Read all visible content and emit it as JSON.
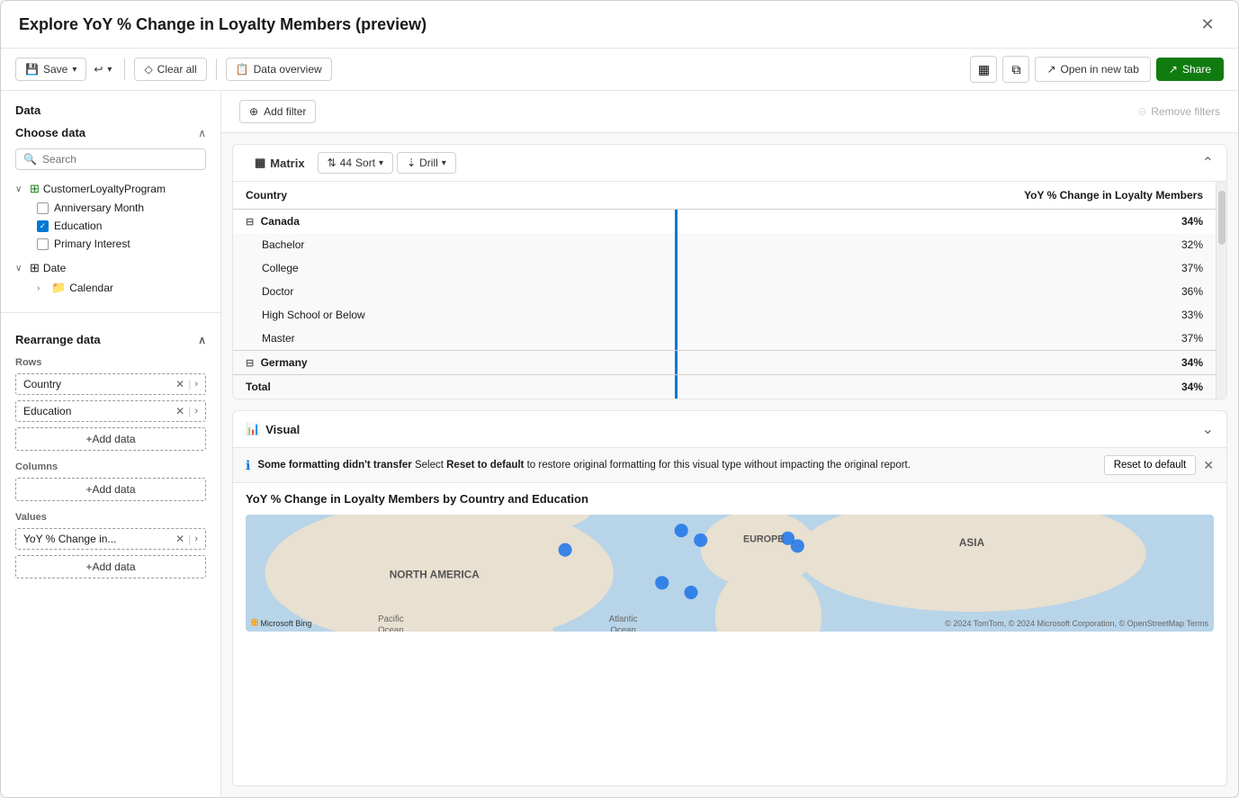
{
  "window": {
    "title": "Explore YoY % Change in Loyalty Members (preview)"
  },
  "toolbar": {
    "save_label": "Save",
    "undo_label": "↩",
    "clear_label": "Clear all",
    "data_overview_label": "Data overview",
    "open_tab_label": "Open in new tab",
    "share_label": "Share",
    "icon_grid": "▦",
    "icon_split": "⧉"
  },
  "sidebar": {
    "data_section_title": "Data",
    "choose_data_title": "Choose data",
    "search_placeholder": "Search",
    "tree": {
      "customer_loyalty": "CustomerLoyaltyProgram",
      "anniversary_month": "Anniversary Month",
      "education": "Education",
      "primary_interest": "Primary Interest",
      "date": "Date",
      "calendar": "Calendar",
      "anniversary_checked": false,
      "education_checked": true,
      "primary_checked": false
    },
    "rearrange_title": "Rearrange data",
    "rows_label": "Rows",
    "columns_label": "Columns",
    "values_label": "Values",
    "country_chip": "Country",
    "education_chip": "Education",
    "yoy_chip": "YoY % Change in...",
    "add_data_label": "+Add data"
  },
  "filter_bar": {
    "add_filter_label": "Add filter",
    "remove_filters_label": "Remove filters"
  },
  "matrix": {
    "toolbar": {
      "matrix_label": "Matrix",
      "sort_label": "Sort",
      "sort_count": "44",
      "drill_label": "Drill"
    },
    "columns": [
      "Country",
      "YoY % Change in Loyalty Members"
    ],
    "rows": [
      {
        "label": "Canada",
        "value": "34%",
        "is_country": true,
        "indent": 0
      },
      {
        "label": "Bachelor",
        "value": "32%",
        "is_country": false,
        "indent": 1
      },
      {
        "label": "College",
        "value": "37%",
        "is_country": false,
        "indent": 1
      },
      {
        "label": "Doctor",
        "value": "36%",
        "is_country": false,
        "indent": 1
      },
      {
        "label": "High School or Below",
        "value": "33%",
        "is_country": false,
        "indent": 1
      },
      {
        "label": "Master",
        "value": "37%",
        "is_country": false,
        "indent": 1
      },
      {
        "label": "Germany",
        "value": "34%",
        "is_country": true,
        "indent": 0
      },
      {
        "label": "Total",
        "value": "34%",
        "is_total": true,
        "indent": 0
      }
    ]
  },
  "visual": {
    "title": "Visual",
    "map_title": "YoY % Change in Loyalty Members by Country and Education",
    "formatting_notice": "Some formatting didn't transfer",
    "formatting_detail": " Select ",
    "formatting_reset_text": "Reset to default",
    "formatting_suffix": " to restore original formatting for this visual type without impacting the original report.",
    "reset_btn_label": "Reset to default",
    "credits": "© 2024 TomTom, © 2024 Microsoft Corporation, © OpenStreetMap Terms",
    "bing_label": "Microsoft Bing",
    "map_labels": {
      "north_america": "NORTH AMERICA",
      "europe": "EUROPE",
      "asia": "ASIA",
      "pacific": "Pacific\nOcean",
      "atlantic": "Atlantic\nOcean"
    },
    "dots": [
      {
        "cx": "33%",
        "cy": "38%"
      },
      {
        "cx": "45%",
        "cy": "28%"
      },
      {
        "cx": "47%",
        "cy": "33%"
      },
      {
        "cx": "43%",
        "cy": "55%"
      },
      {
        "cx": "46%",
        "cy": "60%"
      },
      {
        "cx": "56%",
        "cy": "32%"
      },
      {
        "cx": "57%",
        "cy": "36%"
      }
    ]
  }
}
